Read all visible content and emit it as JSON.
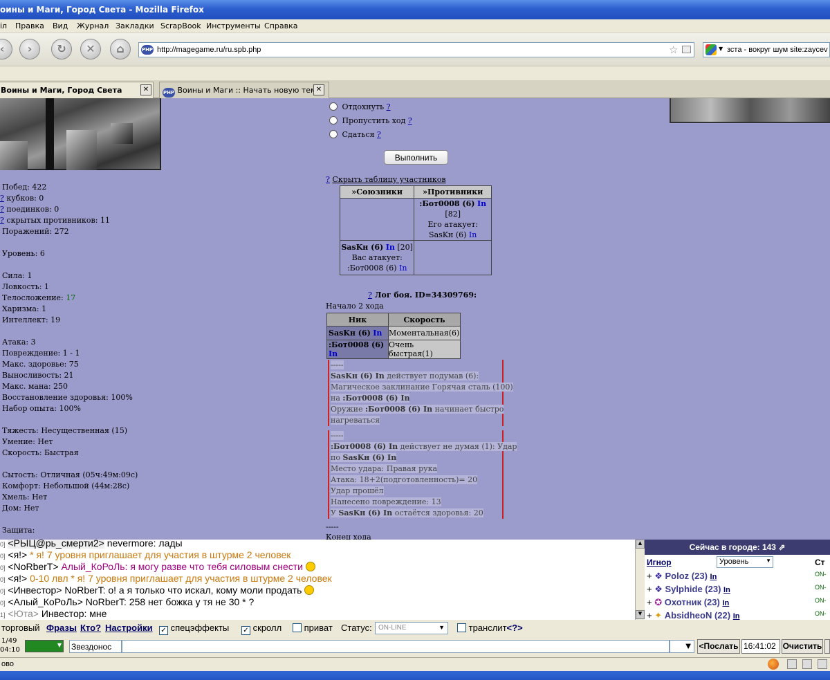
{
  "window": {
    "title": "оины и Маги, Город Света - Mozilla Firefox"
  },
  "menu": [
    "іл",
    "Правка",
    "Вид",
    "Журнал",
    "Закладки",
    "ScrapBook",
    "Инструменты",
    "Справка"
  ],
  "nav": {
    "url": "http://magegame.ru/ru.spb.php",
    "search": "зста - вокруг шум site:zaycev",
    "badge": "PHP"
  },
  "tabs": [
    {
      "label": "Воины и Маги, Город Света",
      "active": true
    },
    {
      "label": "Воины и Маги :: Начать новую тему",
      "active": false
    }
  ],
  "stats": {
    "wins": "Побед: 422",
    "cups": "кубков: 0",
    "duels": "поединков: 0",
    "hidden": "скрытых противников: 11",
    "losses": "Поражений: 272",
    "level": "Уровень: 6",
    "str": "Сила: 1",
    "agi": "Ловкость: 1",
    "con_label": "Телосложение: ",
    "con_value": "17",
    "cha": "Харизма: 1",
    "int": "Интеллект: 19",
    "atk": "Атака: 3",
    "dmg": "Повреждение: 1 - 1",
    "hp": "Макс. здоровье: 75",
    "stamina": "Выносливость: 21",
    "mana": "Макс. мана: 250",
    "regen": "Восстановление здоровья: 100%",
    "exp": "Набор опыта: 100%",
    "weight": "Тяжесть: Несущественная (15)",
    "skill": "Умение: Нет",
    "speed": "Скорость: Быстрая",
    "food": "Сытость: Отличная (05ч:49м:09с)",
    "comfort": "Комфорт: Небольшой (44м:28с)",
    "drunk": "Хмель: Нет",
    "house": "Дом: Нет",
    "defense": "Защита:",
    "q": "?"
  },
  "actions": {
    "options": [
      "Отдохнуть",
      "Пропустить ход",
      "Сдаться"
    ],
    "q": "?",
    "submit": "Выполнить",
    "hide_table": "Скрыть таблицу участников"
  },
  "participants": {
    "allies_header": "»Союзники",
    "enemies_header": "»Противники",
    "enemy_name": ":Бот0008 (6)",
    "enemy_hp": "[82]",
    "enemy_attacks_label": "Его атакует:",
    "enemy_attacked_by": "SasKн (6)",
    "ally_name": "SasKн (6)",
    "ally_hp": "[20]",
    "ally_attacks_label": "Вас атакует:",
    "ally_attacked_by": ":Бот0008 (6)",
    "ln": "In"
  },
  "log": {
    "title": "Лог боя. ID=34309769:",
    "turn_start": "Начало 2 хода",
    "col_nick": "Ник",
    "col_speed": "Скорость",
    "rows": [
      {
        "nick": "SasKн (6)",
        "speed": "Моментальная(6)"
      },
      {
        "nick": ":Бот0008 (6)",
        "speed": "Очень быстрая(1)"
      }
    ],
    "sep": "-----",
    "b1": {
      "actor": "SasKн (6) In",
      "text1": " действует подумав (6):",
      "line2": "Магическое заклинание Горячая сталь (100)",
      "line3a": "на ",
      "line3b": ":Бот0008 (6) In",
      "line4a": "Оружие ",
      "line4b": ":Бот0008 (6) In",
      "line4c": " начинает быстро",
      "line5": "нагреваться"
    },
    "b2": {
      "actor": ":Бот0008 (6) In",
      "text1": " действует не думая (1): Удар",
      "line2a": "по ",
      "line2b": "SasKн (6) In",
      "line3": "Место удара: Правая рука",
      "line4": "Атака: 18+2(подготовленность)= 20",
      "line5": "Удар прошёл",
      "line6": "Нанесено повреждение: 13",
      "line7a": "У ",
      "line7b": "SasKн (6) In",
      "line7c": " остаётся здоровья: 20"
    },
    "end_sep": "-----",
    "turn_end": "Конец хода"
  },
  "chat": [
    {
      "pre": "0]",
      "nick": "<РЫЦ@рь_смерти2>",
      "text": " nevermore: лады",
      "color": "#000000"
    },
    {
      "pre": "0]",
      "nick": "<я!>",
      "text": " * я! 7 уровня приглашает для участия в штурме 2 человек",
      "color": "#c8780a"
    },
    {
      "pre": "0]",
      "nick": "<NoRberT>",
      "text": " Алый_КоРоЛь: я могу разве что тебя силовым снести",
      "color": "#a00080"
    },
    {
      "pre": "0]",
      "nick": "<я!>",
      "text": " 0-10 лвл * я! 7 уровня приглашает для участия в штурме 2 человек",
      "color": "#c8780a"
    },
    {
      "pre": "0]",
      "nick": "<Инвестор>",
      "text": " NoRberT: о! а я только что искал, кому моли продать",
      "color": "#000000"
    },
    {
      "pre": "0]",
      "nick": "<Алый_КоРоЛь>",
      "text": " NoRberT: 258 нет божка у тя не 30 * ?",
      "color": "#000000"
    },
    {
      "pre": "1]",
      "nick": "<Юта>",
      "text": " Инвестор: мне",
      "color": "#000000"
    }
  ],
  "online": {
    "header": "Сейчас в городе: 143",
    "ignore": "Игнор",
    "sort": "Уровень",
    "st": "Ст",
    "users": [
      {
        "name": "Poloz (23)",
        "ln": "In",
        "st": "ON-"
      },
      {
        "name": "Sylphide (23)",
        "ln": "In",
        "st": "ON-"
      },
      {
        "name": "Охотник (23)",
        "ln": "In",
        "st": "ON-"
      },
      {
        "name": "AbsidheoN (22)",
        "ln": "In",
        "st": "ON-"
      }
    ]
  },
  "controls": {
    "prefix": "торговый",
    "phrases": "Фразы",
    "who": "Кто?",
    "settings": "Настройки",
    "fx": "спецэффекты",
    "scroll": "скролл",
    "private": "приват",
    "status_label": "Статус:",
    "status_value": "ON-LINE",
    "translit": "транслит",
    "translit_q": "<?>"
  },
  "input": {
    "counter": "1/49",
    "time_small": "04:10",
    "target": "Звездонос",
    "send": "<Послать",
    "clock": "16:41:02",
    "clear": "Очистить"
  },
  "statusbar": {
    "text": "ово"
  }
}
